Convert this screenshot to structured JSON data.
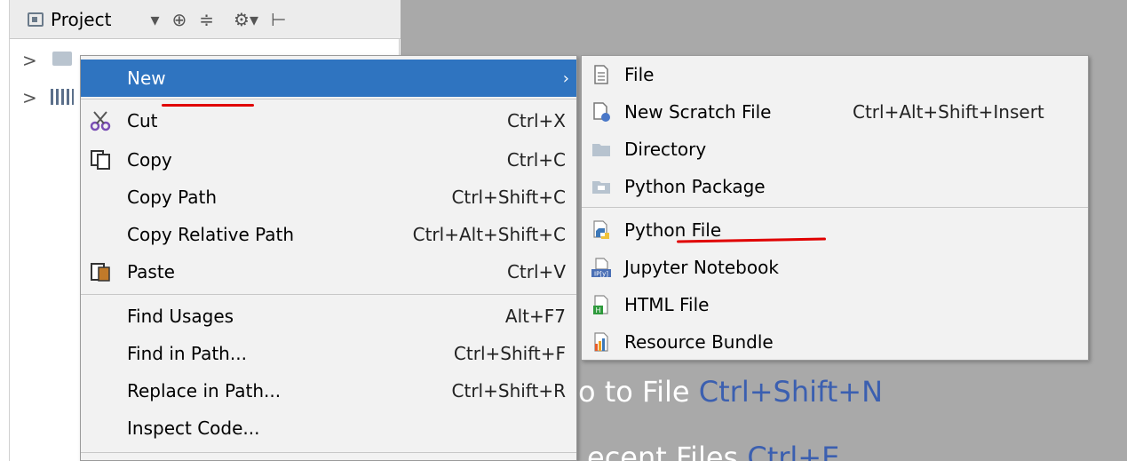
{
  "project_panel": {
    "title": "Project",
    "toolbar_dropdown": "▾",
    "toolbar_target": "⊕",
    "toolbar_collapse": "≑",
    "toolbar_gear": "⚙▾",
    "toolbar_hide": "⊢",
    "tree_expand_1": ">",
    "tree_expand_2": ">"
  },
  "editor": {
    "hint_goto_label": "o to File",
    "hint_goto_shortcut": "Ctrl+Shift+N",
    "hint_recent_label": "ecent Files",
    "hint_recent_shortcut": "Ctrl+E"
  },
  "context_menu": {
    "items": [
      {
        "label": "New",
        "shortcut": "",
        "arrow": "›",
        "icon": ""
      },
      {
        "label": "Cut",
        "shortcut": "Ctrl+X",
        "icon": "scissors-icon"
      },
      {
        "label": "Copy",
        "shortcut": "Ctrl+C",
        "icon": "copy-icon"
      },
      {
        "label": "Copy Path",
        "shortcut": "Ctrl+Shift+C",
        "icon": ""
      },
      {
        "label": "Copy Relative Path",
        "shortcut": "Ctrl+Alt+Shift+C",
        "icon": ""
      },
      {
        "label": "Paste",
        "shortcut": "Ctrl+V",
        "icon": "paste-icon"
      },
      {
        "label": "Find Usages",
        "shortcut": "Alt+F7",
        "icon": ""
      },
      {
        "label": "Find in Path...",
        "shortcut": "Ctrl+Shift+F",
        "icon": ""
      },
      {
        "label": "Replace in Path...",
        "shortcut": "Ctrl+Shift+R",
        "icon": ""
      },
      {
        "label": "Inspect Code...",
        "shortcut": "",
        "icon": ""
      }
    ]
  },
  "submenu": {
    "items": [
      {
        "label": "File",
        "shortcut": "",
        "icon": "file-icon"
      },
      {
        "label": "New Scratch File",
        "shortcut": "Ctrl+Alt+Shift+Insert",
        "icon": "scratch-file-icon"
      },
      {
        "label": "Directory",
        "shortcut": "",
        "icon": "folder-icon"
      },
      {
        "label": "Python Package",
        "shortcut": "",
        "icon": "package-icon"
      },
      {
        "label": "Python File",
        "shortcut": "",
        "icon": "python-file-icon"
      },
      {
        "label": "Jupyter Notebook",
        "shortcut": "",
        "icon": "jupyter-icon"
      },
      {
        "label": "HTML File",
        "shortcut": "",
        "icon": "html-file-icon"
      },
      {
        "label": "Resource Bundle",
        "shortcut": "",
        "icon": "resource-bundle-icon"
      }
    ]
  },
  "colors": {
    "selection": "#2f74c0",
    "annotation_red": "#e00000",
    "editor_bg": "#a9a9a9"
  }
}
